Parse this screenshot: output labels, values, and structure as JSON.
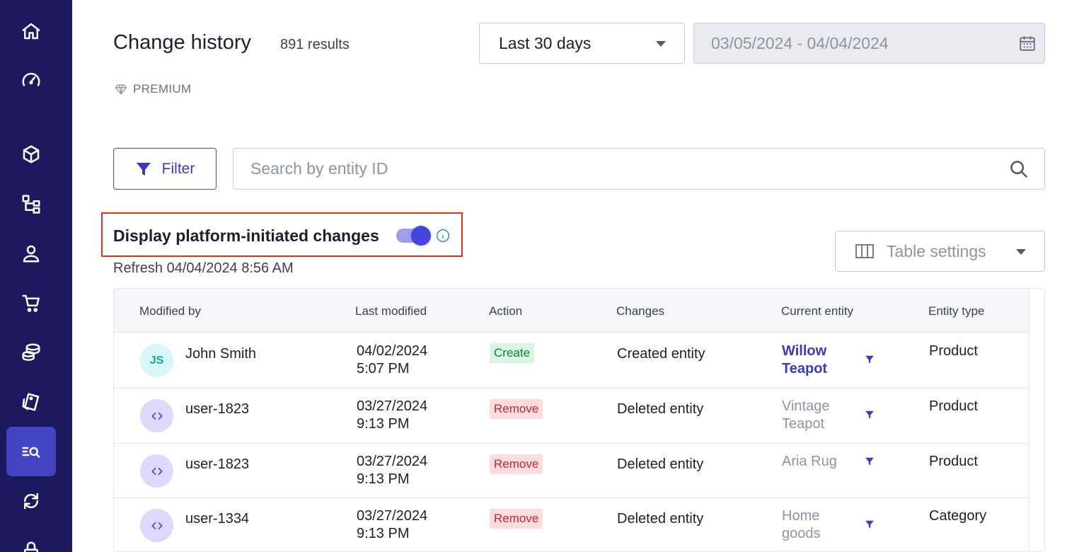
{
  "sidebar": {
    "items": [
      {
        "icon": "home-icon"
      },
      {
        "icon": "dashboard-gauge-icon"
      },
      {
        "icon": "cube-icon"
      },
      {
        "icon": "hierarchy-icon"
      },
      {
        "icon": "user-icon"
      },
      {
        "icon": "cart-icon"
      },
      {
        "icon": "database-icon"
      },
      {
        "icon": "tags-icon"
      },
      {
        "icon": "search-list-icon",
        "active": true
      },
      {
        "icon": "sync-icon"
      },
      {
        "icon": "lock-icon"
      }
    ],
    "active_color": "#4544c4",
    "background": "#1b1a5c"
  },
  "header": {
    "title": "Change history",
    "results": "891 results",
    "badge": "PREMIUM",
    "range_select": "Last 30 days",
    "date_range": "03/05/2024 - 04/04/2024"
  },
  "toolbar": {
    "filter_label": "Filter",
    "search_placeholder": "Search by entity ID",
    "toggle_label": "Display platform-initiated changes",
    "toggle_on": true,
    "refresh": "Refresh 04/04/2024 8:56 AM",
    "table_settings": "Table settings"
  },
  "table": {
    "columns": [
      "Modified by",
      "Last modified",
      "Action",
      "Changes",
      "Current entity",
      "Entity type"
    ],
    "rows": [
      {
        "avatar": "JS",
        "avatar_type": "person",
        "modified_by": "John Smith",
        "date": "04/02/2024",
        "time": "5:07 PM",
        "action": "Create",
        "changes": "Created entity",
        "entity_line1": "Willow",
        "entity_line2": "Teapot",
        "entity_live": true,
        "entity_type": "Product"
      },
      {
        "avatar": "",
        "avatar_type": "code",
        "modified_by": "user-1823",
        "date": "03/27/2024",
        "time": "9:13 PM",
        "action": "Remove",
        "changes": "Deleted entity",
        "entity_line1": "Vintage",
        "entity_line2": "Teapot",
        "entity_live": false,
        "entity_type": "Product"
      },
      {
        "avatar": "",
        "avatar_type": "code",
        "modified_by": "user-1823",
        "date": "03/27/2024",
        "time": "9:13 PM",
        "action": "Remove",
        "changes": "Deleted entity",
        "entity_line1": "Aria Rug",
        "entity_line2": "",
        "entity_live": false,
        "entity_type": "Product"
      },
      {
        "avatar": "",
        "avatar_type": "code",
        "modified_by": "user-1334",
        "date": "03/27/2024",
        "time": "9:13 PM",
        "action": "Remove",
        "changes": "Deleted entity",
        "entity_line1": "Home",
        "entity_line2": "goods",
        "entity_live": false,
        "entity_type": "Category"
      }
    ]
  },
  "colors": {
    "accent": "#4544dd",
    "highlight_frame": "#e0301e",
    "create_badge": "#d8f5e1",
    "remove_badge": "#fbdcdf"
  }
}
